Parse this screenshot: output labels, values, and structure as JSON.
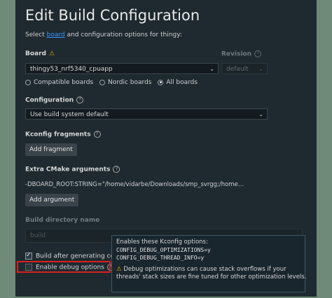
{
  "title": "Edit Build Configuration",
  "subtitle": {
    "prefix": "Select ",
    "link": "board",
    "suffix": " and configuration options for thingy:"
  },
  "board": {
    "label": "Board",
    "value": "thingy53_nrf5340_cpuapp",
    "radios": [
      {
        "label": "Compatible boards",
        "selected": false
      },
      {
        "label": "Nordic boards",
        "selected": false
      },
      {
        "label": "All boards",
        "selected": true
      }
    ]
  },
  "revision": {
    "label": "Revision",
    "value": "default"
  },
  "configuration": {
    "label": "Configuration",
    "value": "Use build system default"
  },
  "kconfig": {
    "label": "Kconfig fragments",
    "button": "Add fragment"
  },
  "cmake": {
    "label": "Extra CMake arguments",
    "value": "-DBOARD_ROOT:STRING=\"/home/vidarbe/Downloads/smp_svrgg;/home…",
    "button": "Add argument"
  },
  "build_dir": {
    "label": "Build directory name",
    "value": "build"
  },
  "checks": [
    {
      "label": "Build after generating con",
      "checked": true
    },
    {
      "label": "Enable debug options",
      "checked": false
    }
  ],
  "tooltip": {
    "heading": "Enables these Kconfig options:",
    "options": [
      "CONFIG_DEBUG_OPTIMIZATIONS=y",
      "CONFIG_DEBUG_THREAD_INFO=y"
    ],
    "warning_1": "Debug optimizations can cause stack overflows if your",
    "warning_2": "threads' stack sizes are fine tuned for other optimization levels."
  },
  "colors": {
    "background": "#1f2a30",
    "accent_link": "#3794ff",
    "warning": "#d9b100",
    "highlight": "#d92020"
  },
  "icons": [
    "warning-icon",
    "help-icon",
    "chevron-down-icon",
    "check-icon"
  ]
}
